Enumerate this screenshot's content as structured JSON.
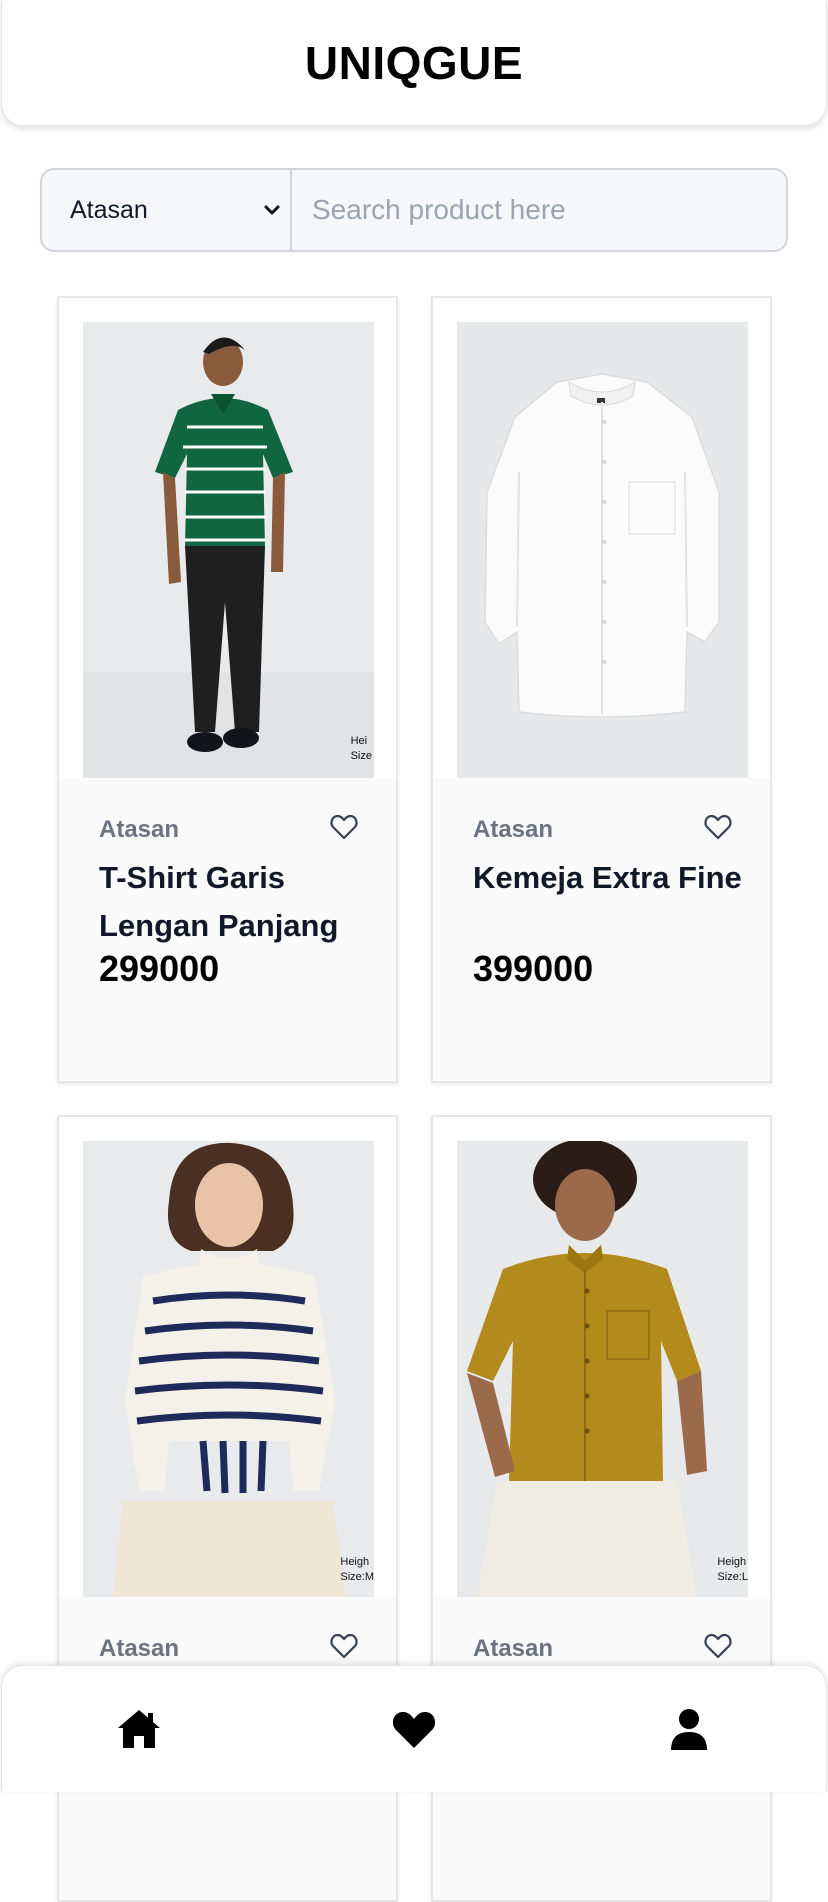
{
  "header": {
    "title": "UNIQGUE"
  },
  "search": {
    "category_selected": "Atasan",
    "placeholder": "Search product here"
  },
  "products": [
    {
      "category": "Atasan",
      "name": "T-Shirt Garis Lengan Panjang",
      "price": "299000",
      "image": "green-striped-polo-man",
      "image_tag": "Hei\nSize"
    },
    {
      "category": "Atasan",
      "name": "Kemeja Extra Fine",
      "price": "399000",
      "image": "white-shirt"
    },
    {
      "category": "Atasan",
      "name": "",
      "price": "",
      "image": "striped-sweater-woman",
      "image_tag": "Heigh\nSize:M"
    },
    {
      "category": "Atasan",
      "name": "",
      "price": "",
      "image": "mustard-shirt-man",
      "image_tag": "Heigh\nSize:L"
    }
  ],
  "bottom_nav": [
    {
      "icon": "home-icon"
    },
    {
      "icon": "heart-icon"
    },
    {
      "icon": "user-icon"
    }
  ]
}
